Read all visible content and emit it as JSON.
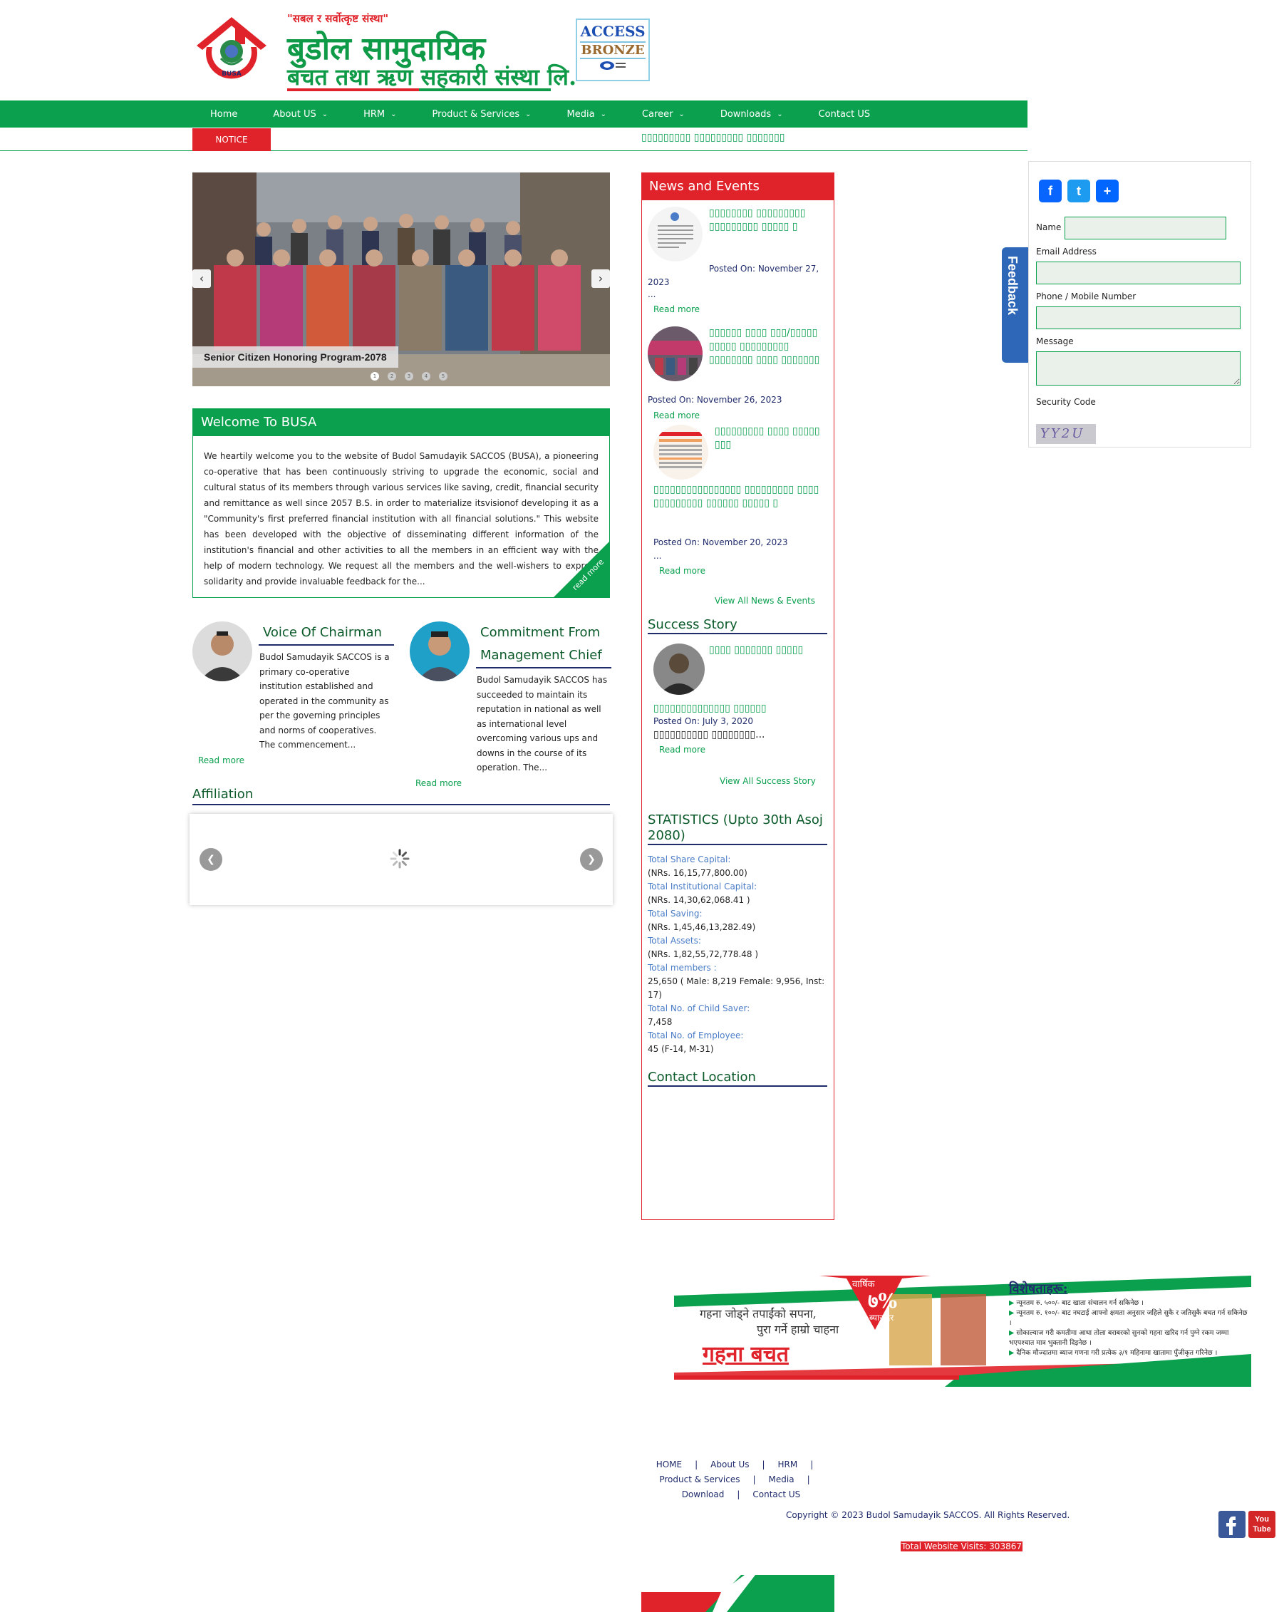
{
  "header": {
    "slogan": "\"सबल र सर्वोत्कृष्ट संस्था\"",
    "org_name_line1": "बुडोल सामुदायिक",
    "org_name_line2": "बचत तथा ऋण सहकारी संस्था लि.",
    "logo_text": "BUSA",
    "badge_line1": "ACCESS",
    "badge_line2": "BRONZE"
  },
  "nav": {
    "items": [
      {
        "label": "Home",
        "has_menu": false
      },
      {
        "label": "About US",
        "has_menu": true
      },
      {
        "label": "HRM",
        "has_menu": true
      },
      {
        "label": "Product & Services",
        "has_menu": true
      },
      {
        "label": "Media",
        "has_menu": true
      },
      {
        "label": "Career",
        "has_menu": true
      },
      {
        "label": "Downloads",
        "has_menu": true
      },
      {
        "label": "Contact US",
        "has_menu": false
      }
    ]
  },
  "notice": {
    "label": "NOTICE",
    "ticker": "▯▯▯▯▯▯▯▯▯ ▯▯▯▯▯▯▯▯▯ ▯▯▯▯▯▯▯"
  },
  "slider": {
    "caption": "Senior Citizen Honoring Program-2078",
    "dots": [
      "1",
      "2",
      "3",
      "4",
      "5"
    ]
  },
  "welcome": {
    "title": "Welcome To BUSA",
    "text": "We heartily welcome you to the website of Budol Samudayik SACCOS (BUSA), a pioneering co-operative that has been continuously striving to upgrade the economic, social and cultural status of its members through various services like saving, credit, financial security and remittance as well since 2057 B.S. in order to materialize itsvisionof developing it as a \"Community's first preferred financial institution with all financial solutions.\" This website has been developed with the objective of disseminating different information of the institution's financial and other activities to all the members in an efficient way with the help of modern technology. We request all the members and the well-wishers to express solidarity and provide invaluable feedback for the...",
    "read_more": "read more"
  },
  "chairman": {
    "title": "Voice Of Chairman",
    "text": "Budol Samudayik SACCOS is a primary co-operative institution established and operated in the community as per the governing principles and norms of cooperatives. The commencement...",
    "read_more": "Read more"
  },
  "management": {
    "title": "Commitment From Management Chief",
    "text": "Budol Samudayik SACCOS has succeeded to maintain its reputation in national as well as international level overcoming various ups and downs in the course of its operation. The...",
    "read_more": "Read more"
  },
  "affiliation": {
    "title": "Affiliation"
  },
  "news": {
    "title": "News and Events",
    "items": [
      {
        "headline": "▯▯▯▯▯▯▯▯ ▯▯▯▯▯▯▯▯▯ ▯▯▯▯▯▯▯▯▯ ▯▯▯▯▯ ▯",
        "posted": "Posted On: November 27, 2023",
        "ellipsis": "...",
        "read_more": "Read more"
      },
      {
        "headline": "▯▯▯▯▯▯ ▯▯▯▯ ▯▯▯/▯▯▯▯▯ ▯▯▯▯▯ ▯▯▯▯▯▯▯▯▯ ▯▯▯▯▯▯▯▯ ▯▯▯▯ ▯▯▯▯▯▯▯",
        "posted": "Posted On: November 26, 2023",
        "read_more": "Read more"
      },
      {
        "headline": "▯▯▯▯▯▯▯▯▯ ▯▯▯▯ ▯▯▯▯▯ ▯▯▯",
        "extra": "▯▯▯▯▯▯▯▯▯▯▯▯▯▯▯▯ ▯▯▯▯▯▯▯▯▯ ▯▯▯▯ ▯▯▯▯▯▯▯▯▯ ▯▯▯▯▯▯ ▯▯▯▯▯ ▯",
        "posted": "Posted On: November 20, 2023",
        "ellipsis": "...",
        "read_more": "Read more"
      }
    ],
    "view_all": "View All News & Events"
  },
  "success": {
    "title": "Success Story",
    "headline": "▯▯▯▯ ▯▯▯▯▯▯▯ ▯▯▯▯▯",
    "extra": "▯▯▯▯▯▯▯▯▯▯▯▯▯▯ ▯▯▯▯▯▯",
    "posted": "Posted On: July 3, 2020",
    "summary": "▯▯▯▯▯▯▯▯▯▯ ▯▯▯▯▯▯▯▯...",
    "read_more": "Read more",
    "view_all": "View All Success Story"
  },
  "statistics": {
    "title": "STATISTICS (Upto 30th Asoj 2080)",
    "rows": [
      {
        "label": "Total Share Capital:",
        "value": "(NRs. 16,15,77,800.00)"
      },
      {
        "label": "Total Institutional Capital:",
        "value": "(NRs. 14,30,62,068.41 )"
      },
      {
        "label": "Total Saving:",
        "value": "(NRs. 1,45,46,13,282.49)"
      },
      {
        "label": "Total Assets:",
        "value": "(NRs. 1,82,55,72,778.48 )"
      },
      {
        "label": "Total members :",
        "value": "25,650 ( Male: 8,219 Female: 9,956, Inst: 17)"
      },
      {
        "label": "Total No. of Child Saver:",
        "value": "7,458"
      },
      {
        "label": "Total No. of Employee:",
        "value": "45 (F-14, M-31)"
      }
    ]
  },
  "contact": {
    "title": "Contact Location"
  },
  "feedback": {
    "tab_label": "Feedback",
    "share": {
      "facebook": "f",
      "twitter": "t",
      "share": "+"
    },
    "fields": {
      "name": "Name",
      "email": "Email Address",
      "phone": "Phone / Mobile Number",
      "message": "Message",
      "security": "Security Code"
    },
    "captcha": "YY2U"
  },
  "ad": {
    "rate_label": "वार्षिक",
    "rate": "७%",
    "rate_sub": "ब्याजदर",
    "tagline1": "गहना जोड्ने तपाईंको सपना,",
    "tagline2": "पुरा गर्ने हाम्रो चाहना",
    "product": "गहना बचत",
    "features_title": "विशेषताहरू:",
    "features": [
      "न्यूनतम रु. ५००/- बाट खाता संचालन गर्न सकिनेछ ।",
      "न्यूनतम रु. १००/- बाट नघटाई आफ्नो क्षमता अनुसार जहिले सुकै र जतिसुकै बचत गर्न सकिनेछ ।",
      "सोकाल्याज गरी कमतीमा आधा तोला बराबरको सुनको गहना खरिद गर्न पुग्ने रकम जम्मा भएपश्चात मात्र भुक्तानी दिइनेछ ।",
      "दैनिक मौज्दातमा ब्याज गणना गरी प्रत्येक ३/१ महिनामा खातामा पुँजीकृत गरिनेछ ।"
    ]
  },
  "footer": {
    "links": [
      "HOME",
      "About Us",
      "HRM",
      "Product & Services",
      "Media",
      "Download",
      "Contact US"
    ],
    "copyright": "Copyright © 2023 Budol Samudayik SACCOS. All Rights Reserved.",
    "visits": "Total Website Visits: 303867",
    "youtube": "You Tube"
  },
  "colors": {
    "brand_green": "#0aa04e",
    "brand_red": "#e0232a",
    "navy": "#1f2b6b"
  }
}
